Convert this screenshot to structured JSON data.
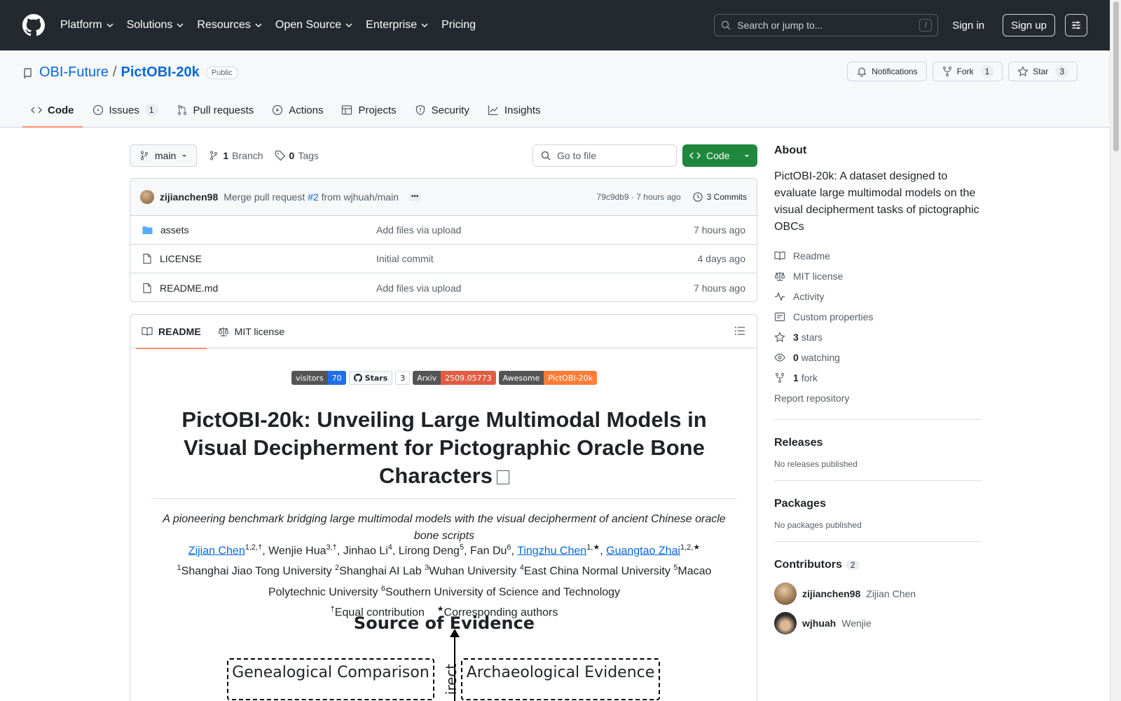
{
  "header": {
    "nav": [
      "Platform",
      "Solutions",
      "Resources",
      "Open Source",
      "Enterprise"
    ],
    "pricing": "Pricing",
    "search_placeholder": "Search or jump to...",
    "slash_key": "/",
    "signin": "Sign in",
    "signup": "Sign up"
  },
  "repo": {
    "owner": "OBI-Future",
    "separator": "/",
    "name": "PictOBI-20k",
    "visibility": "Public",
    "notifications": "Notifications",
    "fork_label": "Fork",
    "fork_count": "1",
    "star_label": "Star",
    "star_count": "3"
  },
  "tabs": [
    {
      "label": "Code",
      "icon": "code-icon"
    },
    {
      "label": "Issues",
      "count": "1",
      "icon": "issue-icon"
    },
    {
      "label": "Pull requests",
      "icon": "pull-request-icon"
    },
    {
      "label": "Actions",
      "icon": "play-icon"
    },
    {
      "label": "Projects",
      "icon": "table-icon"
    },
    {
      "label": "Security",
      "icon": "shield-icon"
    },
    {
      "label": "Insights",
      "icon": "graph-icon"
    }
  ],
  "branch": {
    "name": "main",
    "branch_count": "1",
    "branch_label": "Branch",
    "tag_count": "0",
    "tag_label": "Tags",
    "goto_placeholder": "Go to file",
    "code_button": "Code"
  },
  "commit": {
    "author": "zijianchen98",
    "msg_prefix": "Merge pull request",
    "pr": "#2",
    "msg_suffix": "from wjhuah/main",
    "ellipsis": "•••",
    "hash": "79c9db9",
    "sep": "·",
    "time": "7 hours ago",
    "commits": "3 Commits"
  },
  "files": [
    {
      "name": "assets",
      "type": "folder",
      "message": "Add files via upload",
      "time": "7 hours ago"
    },
    {
      "name": "LICENSE",
      "type": "file",
      "message": "Initial commit",
      "time": "4 days ago"
    },
    {
      "name": "README.md",
      "type": "file",
      "message": "Add files via upload",
      "time": "7 hours ago"
    }
  ],
  "readme": {
    "tab_readme": "README",
    "tab_license": "MIT license",
    "shields": {
      "visitors_label": "visitors",
      "visitors_value": "70",
      "stars_label": "Stars",
      "stars_count": "3",
      "arxiv_label": "Arxiv",
      "arxiv_value": "2509.05773",
      "awesome_label": "Awesome",
      "awesome_value": "PictOBI-20k"
    },
    "title": "PictOBI-20k: Unveiling Large Multimodal Models in Visual Decipherment for Pictographic Oracle Bone Characters",
    "subtitle": "A pioneering benchmark bridging large multimodal models with the visual decipherment of ancient Chinese oracle bone scripts",
    "authors": {
      "a1": "Zijian Chen",
      "a1_sup": "1,2,†",
      "sep1": ", ",
      "a2": "Wenjie Hua",
      "a2_sup": "3,†",
      "a3": "Jinhao Li",
      "a3_sup": "4",
      "a4": "Lirong Deng",
      "a4_sup": "5",
      "a5": "Fan Du",
      "a5_sup": "6",
      "a6": "Tingzhu Chen",
      "a6_sup": "1,★",
      "a7": "Guangtao Zhai",
      "a7_sup": "1,2,★"
    },
    "affil": {
      "s1": "1",
      "u1": "Shanghai Jiao Tong University",
      "s2": "2",
      "u2": "Shanghai AI Lab",
      "s3": "3",
      "u3": "Wuhan University",
      "s4": "4",
      "u4": "East China Normal University",
      "s5": "5",
      "u5": "Macao Polytechnic University",
      "s6": "6",
      "u6": "Southern University of Science and Technology"
    },
    "notes": {
      "dagger": "†",
      "equal": "Equal contribution",
      "star": "★",
      "corr": "Corresponding authors"
    },
    "figure": {
      "title": "Source of Evidence",
      "left_box": "Genealogical Comparison",
      "right_box": "Archaeological Evidence",
      "arrow_label": "irect"
    }
  },
  "about": {
    "heading": "About",
    "description": "PictOBI-20k: A dataset designed to evaluate large multimodal models on the visual decipherment tasks of pictographic OBCs",
    "readme": "Readme",
    "license": "MIT license",
    "activity": "Activity",
    "custom": "Custom properties",
    "stars_n": "3",
    "stars": "stars",
    "watching_n": "0",
    "watching": "watching",
    "fork_n": "1",
    "fork": "fork",
    "report": "Report repository"
  },
  "releases": {
    "heading": "Releases",
    "empty": "No releases published"
  },
  "packages": {
    "heading": "Packages",
    "empty": "No packages published"
  },
  "contributors": {
    "heading": "Contributors",
    "count": "2",
    "list": [
      {
        "login": "zijianchen98",
        "name": "Zijian Chen"
      },
      {
        "login": "wjhuah",
        "name": "Wenjie"
      }
    ]
  }
}
